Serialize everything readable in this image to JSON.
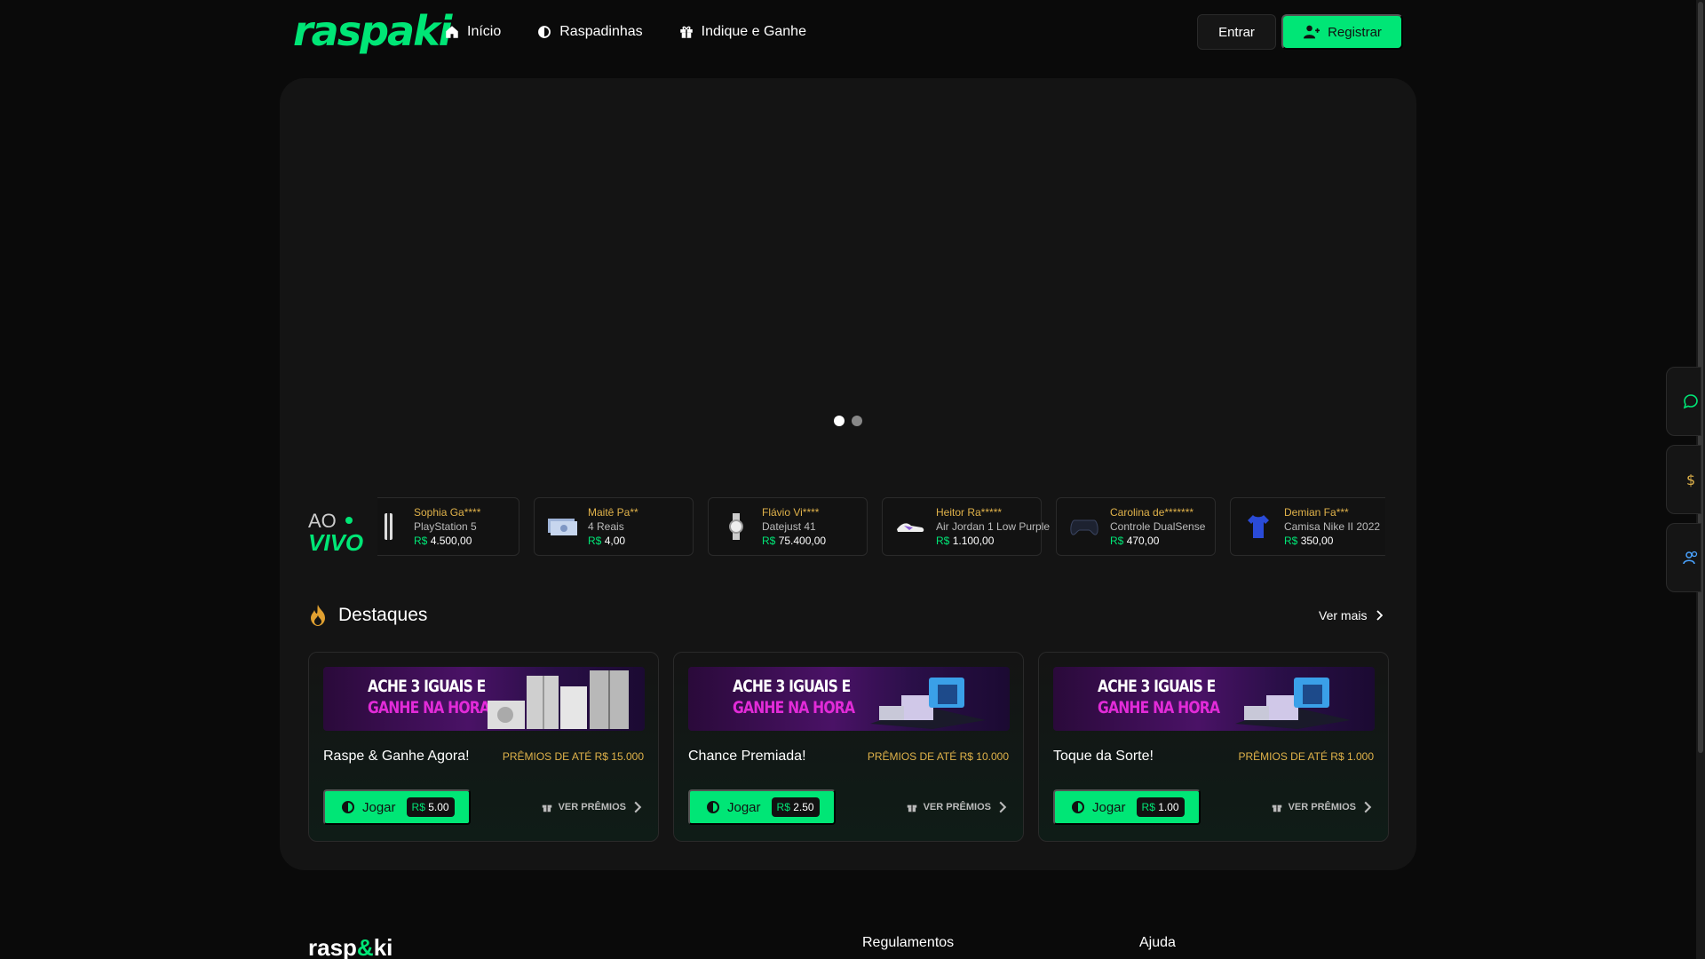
{
  "header": {
    "logo": "raspaki",
    "nav": [
      {
        "label": "Início",
        "icon": "home-icon"
      },
      {
        "label": "Raspadinhas",
        "icon": "coin-icon"
      },
      {
        "label": "Indique e Ganhe",
        "icon": "gift-icon"
      }
    ],
    "login_label": "Entrar",
    "register_label": "Registrar"
  },
  "live": {
    "label_ao": "AO",
    "label_vivo": "VIVO",
    "wins": [
      {
        "name": "Sophia Ga****",
        "item": "PlayStation 5",
        "currency": "R$",
        "value": "4.500,00",
        "icon": "playstation-icon"
      },
      {
        "name": "Maitê Pa**",
        "item": "4 Reais",
        "currency": "R$",
        "value": "4,00",
        "icon": "banknote-icon"
      },
      {
        "name": "Flávio Vi****",
        "item": "Datejust 41",
        "currency": "R$",
        "value": "75.400,00",
        "icon": "watch-icon"
      },
      {
        "name": "Heitor Ra*****",
        "item": "Air Jordan 1 Low Purple",
        "currency": "R$",
        "value": "1.100,00",
        "icon": "sneaker-icon"
      },
      {
        "name": "Carolina de*******",
        "item": "Controle DualSense",
        "currency": "R$",
        "value": "470,00",
        "icon": "gamepad-icon"
      },
      {
        "name": "Demian Fa***",
        "item": "Camisa Nike II 2022",
        "currency": "R$",
        "value": "350,00",
        "icon": "shirt-icon"
      }
    ]
  },
  "featured": {
    "title": "Destaques",
    "see_more": "Ver mais",
    "cards": [
      {
        "banner_l1": "ACHE 3 IGUAIS E",
        "banner_l2": "GANHE NA HORA",
        "title": "Raspe & Ganhe Agora!",
        "prize": "PRÊMIOS DE ATÉ R$ 15.000",
        "play": "Jogar",
        "currency": "R$",
        "price": "5.00",
        "see_prizes": "VER PRÊMIOS"
      },
      {
        "banner_l1": "ACHE 3 IGUAIS E",
        "banner_l2": "GANHE NA HORA",
        "title": "Chance Premiada!",
        "prize": "PRÊMIOS DE ATÉ R$ 10.000",
        "play": "Jogar",
        "currency": "R$",
        "price": "2.50",
        "see_prizes": "VER PRÊMIOS"
      },
      {
        "banner_l1": "ACHE 3 IGUAIS E",
        "banner_l2": "GANHE NA HORA",
        "title": "Toque da Sorte!",
        "prize": "PRÊMIOS DE ATÉ R$ 1.000",
        "play": "Jogar",
        "currency": "R$",
        "price": "1.00",
        "see_prizes": "VER PRÊMIOS"
      }
    ]
  },
  "footer": {
    "logo_pre": "rasp",
    "logo_amp": "&",
    "logo_post": "ki",
    "col1": "Regulamentos",
    "col2": "Ajuda"
  },
  "colors": {
    "accent": "#00e676",
    "gold": "#e0b24a",
    "background": "#0a0a0a",
    "panel": "#141414"
  }
}
